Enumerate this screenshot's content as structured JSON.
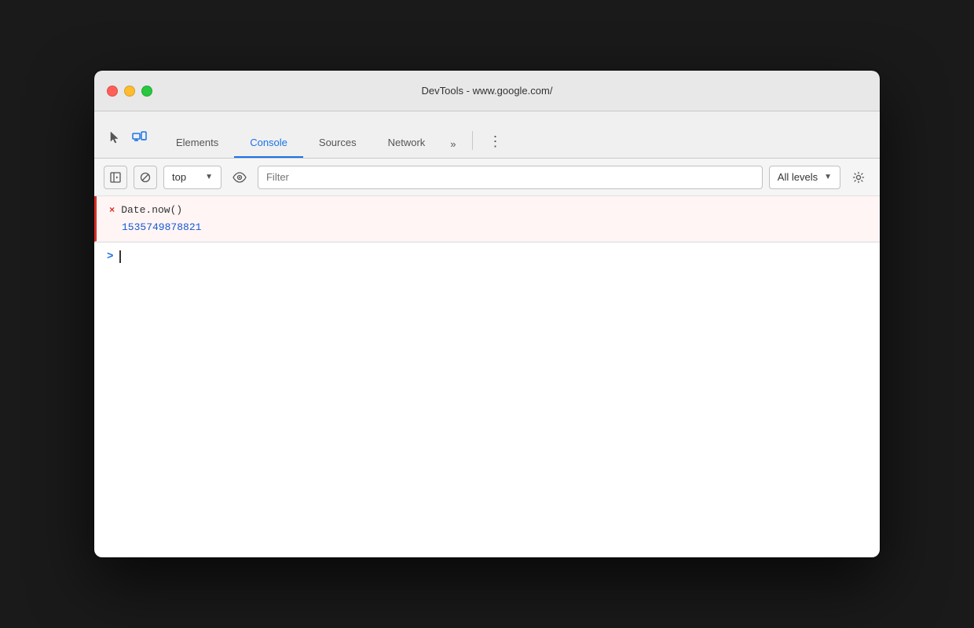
{
  "window": {
    "title": "DevTools - www.google.com/",
    "traffic_lights": {
      "close_label": "close",
      "minimize_label": "minimize",
      "maximize_label": "maximize"
    }
  },
  "tabs": {
    "items": [
      {
        "id": "elements",
        "label": "Elements",
        "active": false
      },
      {
        "id": "console",
        "label": "Console",
        "active": true
      },
      {
        "id": "sources",
        "label": "Sources",
        "active": false
      },
      {
        "id": "network",
        "label": "Network",
        "active": false
      }
    ],
    "more_label": "»",
    "menu_label": "⋮"
  },
  "toolbar": {
    "clear_label": "",
    "block_label": "",
    "context_value": "top",
    "filter_placeholder": "Filter",
    "levels_label": "All levels",
    "settings_label": ""
  },
  "console": {
    "entry": {
      "prefix": "×",
      "command": "Date.now()",
      "result": "1535749878821"
    },
    "input": {
      "prompt": ">"
    }
  },
  "colors": {
    "accent_blue": "#1a73e8",
    "active_tab_blue": "#1558d6",
    "error_red": "#d93025",
    "result_blue": "#1558d6"
  }
}
